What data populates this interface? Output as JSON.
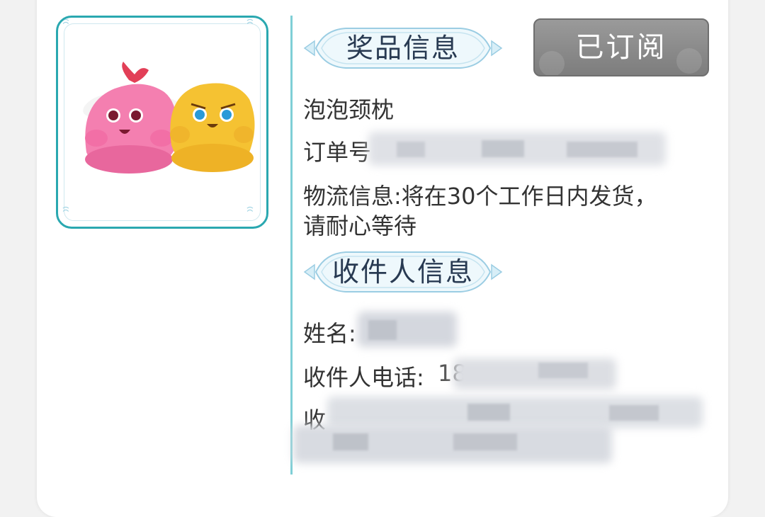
{
  "prize": {
    "section_title": "奖品信息",
    "name": "泡泡颈枕",
    "order_label": "订单号",
    "logistics": "物流信息:将在30个工作日内发货，",
    "logistics_line2": "请耐心等待"
  },
  "subscribe_button": "已订阅",
  "recipient": {
    "section_title": "收件人信息",
    "name_label": "姓名:",
    "phone_label": "收件人电话:",
    "phone_partial": "18",
    "address_label": "收"
  },
  "icons": {
    "product_image": "plush-neck-pillow-image",
    "corner": "swirl-corner-icon"
  },
  "colors": {
    "frame_border": "#2aa8b0",
    "divider": "#7fcfd6",
    "button_bg": "#8c8c8c",
    "text": "#333333"
  }
}
